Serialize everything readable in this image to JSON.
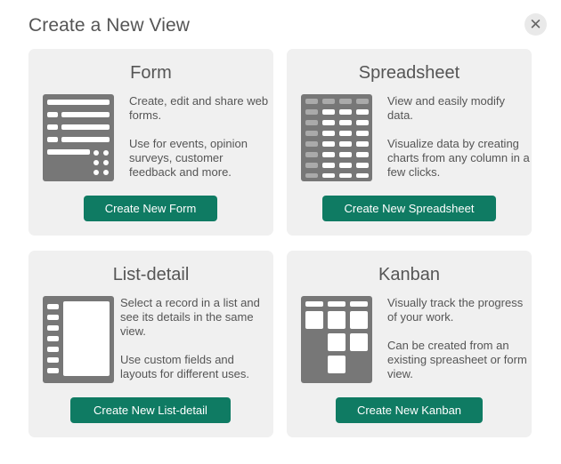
{
  "dialog": {
    "title": "Create a New View",
    "close_icon": "close-icon"
  },
  "cards": [
    {
      "title": "Form",
      "icon": "form-illustration-icon",
      "descriptions": [
        "Create, edit and share web forms.",
        "Use for events, opinion surveys, customer feedback and more."
      ],
      "button_label": "Create New Form"
    },
    {
      "title": "Spreadsheet",
      "icon": "spreadsheet-illustration-icon",
      "descriptions": [
        "View and easily modify data.",
        "Visualize data by creating charts from any column in a few clicks."
      ],
      "button_label": "Create New Spreadsheet"
    },
    {
      "title": "List-detail",
      "icon": "list-detail-illustration-icon",
      "descriptions": [
        "Select a record in a list and see its details in the same view.",
        "Use custom fields and layouts for different uses."
      ],
      "button_label": "Create New List-detail"
    },
    {
      "title": "Kanban",
      "icon": "kanban-illustration-icon",
      "descriptions": [
        "Visually track the progress of your work.",
        "Can be created from an existing spreasheet or form view."
      ],
      "button_label": "Create New Kanban"
    }
  ],
  "colors": {
    "accent": "#0f7b63",
    "card_background": "#f0f0f0",
    "illustration": "#777777"
  }
}
